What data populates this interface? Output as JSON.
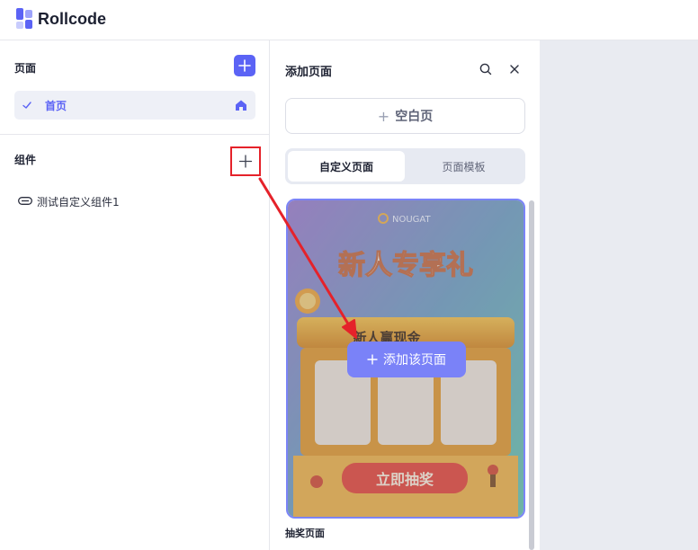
{
  "app": {
    "name": "Rollcode"
  },
  "left_panel": {
    "pages_title": "页面",
    "pages": [
      {
        "label": "首页",
        "selected": true
      }
    ],
    "components_title": "组件",
    "components": [
      {
        "label": "测试自定义组件1"
      }
    ]
  },
  "add_page_panel": {
    "title": "添加页面",
    "blank_label": "空白页",
    "tabs": [
      {
        "label": "自定义页面",
        "active": true
      },
      {
        "label": "页面模板",
        "active": false
      }
    ],
    "template_card": {
      "name": "抽奖页面",
      "add_button_label": "添加该页面",
      "art_text": {
        "brand": "NOUGAT",
        "headline": "新人专享礼",
        "machine_title": "新人赢现金",
        "button": "立即抽奖"
      }
    }
  },
  "colors": {
    "accent": "#5b63f5",
    "annotation": "#e5222a"
  }
}
